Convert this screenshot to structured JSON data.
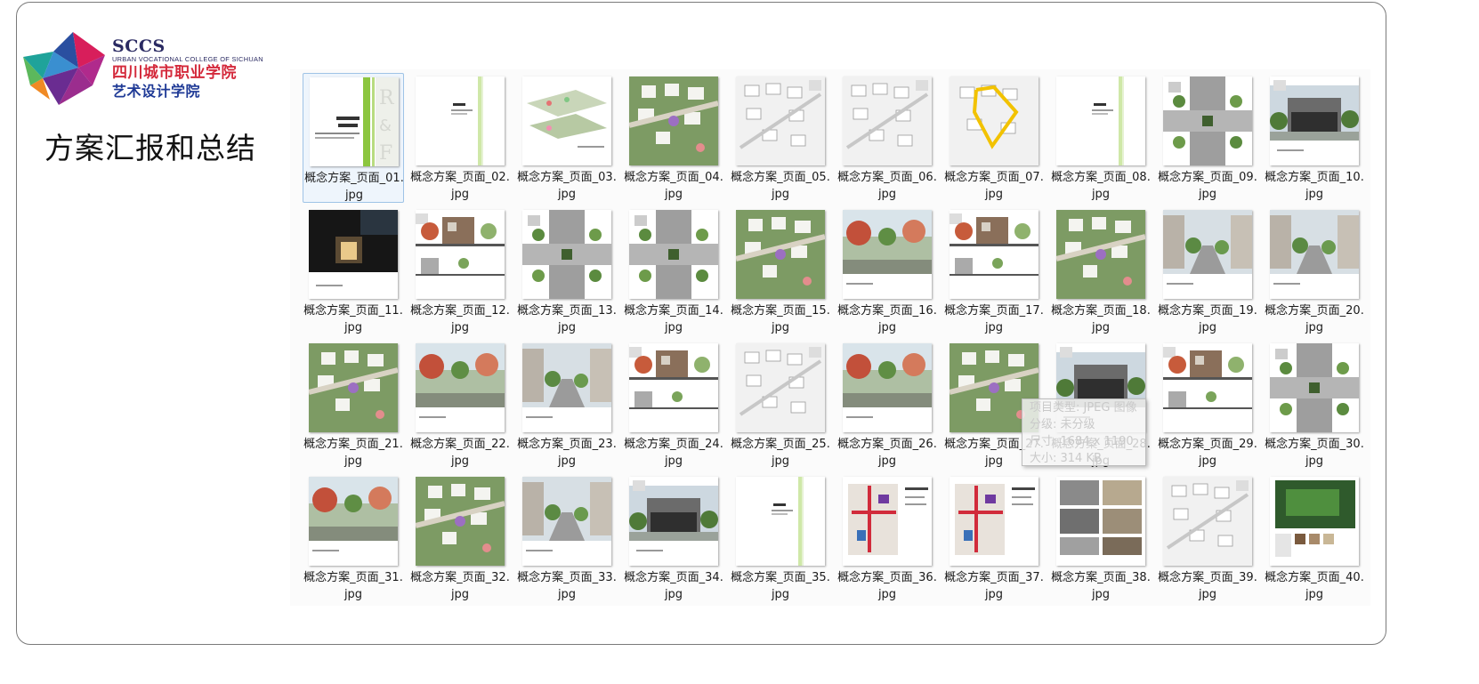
{
  "logo": {
    "short": "SCCS",
    "english": "URBAN VOCATIONAL COLLEGE OF SICHUAN",
    "chinese_name": "四川城市职业学院",
    "department": "艺术设计学院"
  },
  "page_title": "方案汇报和总结",
  "explorer": {
    "selected_index": 0,
    "files": [
      {
        "name": "概念方案_页面_01.jpg",
        "preview": "cover"
      },
      {
        "name": "概念方案_页面_02.jpg",
        "preview": "section"
      },
      {
        "name": "概念方案_页面_03.jpg",
        "preview": "axon"
      },
      {
        "name": "概念方案_页面_04.jpg",
        "preview": "plan-color"
      },
      {
        "name": "概念方案_页面_05.jpg",
        "preview": "plan-gray"
      },
      {
        "name": "概念方案_页面_06.jpg",
        "preview": "plan-gray"
      },
      {
        "name": "概念方案_页面_07.jpg",
        "preview": "plan-yellow"
      },
      {
        "name": "概念方案_页面_08.jpg",
        "preview": "section"
      },
      {
        "name": "概念方案_页面_09.jpg",
        "preview": "plan-detail"
      },
      {
        "name": "概念方案_页面_10.jpg",
        "preview": "render-building"
      },
      {
        "name": "概念方案_页面_11.jpg",
        "preview": "render-night"
      },
      {
        "name": "概念方案_页面_12.jpg",
        "preview": "elevation"
      },
      {
        "name": "概念方案_页面_13.jpg",
        "preview": "plan-detail"
      },
      {
        "name": "概念方案_页面_14.jpg",
        "preview": "plan-detail"
      },
      {
        "name": "概念方案_页面_15.jpg",
        "preview": "plan-color"
      },
      {
        "name": "概念方案_页面_16.jpg",
        "preview": "render-garden"
      },
      {
        "name": "概念方案_页面_17.jpg",
        "preview": "elevation"
      },
      {
        "name": "概念方案_页面_18.jpg",
        "preview": "plan-color"
      },
      {
        "name": "概念方案_页面_19.jpg",
        "preview": "render-street"
      },
      {
        "name": "概念方案_页面_20.jpg",
        "preview": "render-street"
      },
      {
        "name": "概念方案_页面_21.jpg",
        "preview": "plan-color"
      },
      {
        "name": "概念方案_页面_22.jpg",
        "preview": "render-garden"
      },
      {
        "name": "概念方案_页面_23.jpg",
        "preview": "render-street"
      },
      {
        "name": "概念方案_页面_24.jpg",
        "preview": "elevation"
      },
      {
        "name": "概念方案_页面_25.jpg",
        "preview": "plan-gray"
      },
      {
        "name": "概念方案_页面_26.jpg",
        "preview": "render-garden"
      },
      {
        "name": "概念方案_页面_27.jpg",
        "preview": "plan-color"
      },
      {
        "name": "概念方案_页面_28.jpg",
        "preview": "render-building"
      },
      {
        "name": "概念方案_页面_29.jpg",
        "preview": "elevation"
      },
      {
        "name": "概念方案_页面_30.jpg",
        "preview": "plan-detail"
      },
      {
        "name": "概念方案_页面_31.jpg",
        "preview": "render-garden"
      },
      {
        "name": "概念方案_页面_32.jpg",
        "preview": "plan-color"
      },
      {
        "name": "概念方案_页面_33.jpg",
        "preview": "render-street"
      },
      {
        "name": "概念方案_页面_34.jpg",
        "preview": "render-building"
      },
      {
        "name": "概念方案_页面_35.jpg",
        "preview": "section"
      },
      {
        "name": "概念方案_页面_36.jpg",
        "preview": "plan-red"
      },
      {
        "name": "概念方案_页面_37.jpg",
        "preview": "plan-red"
      },
      {
        "name": "概念方案_页面_38.jpg",
        "preview": "material"
      },
      {
        "name": "概念方案_页面_39.jpg",
        "preview": "plan-gray"
      },
      {
        "name": "概念方案_页面_40.jpg",
        "preview": "material-green"
      }
    ]
  },
  "tooltip": {
    "type": "项目类型: JPEG 图像",
    "rating": "分级: 未分级",
    "dimensions": "尺寸: 1684 x 1190",
    "size": "大小: 314 KB"
  }
}
